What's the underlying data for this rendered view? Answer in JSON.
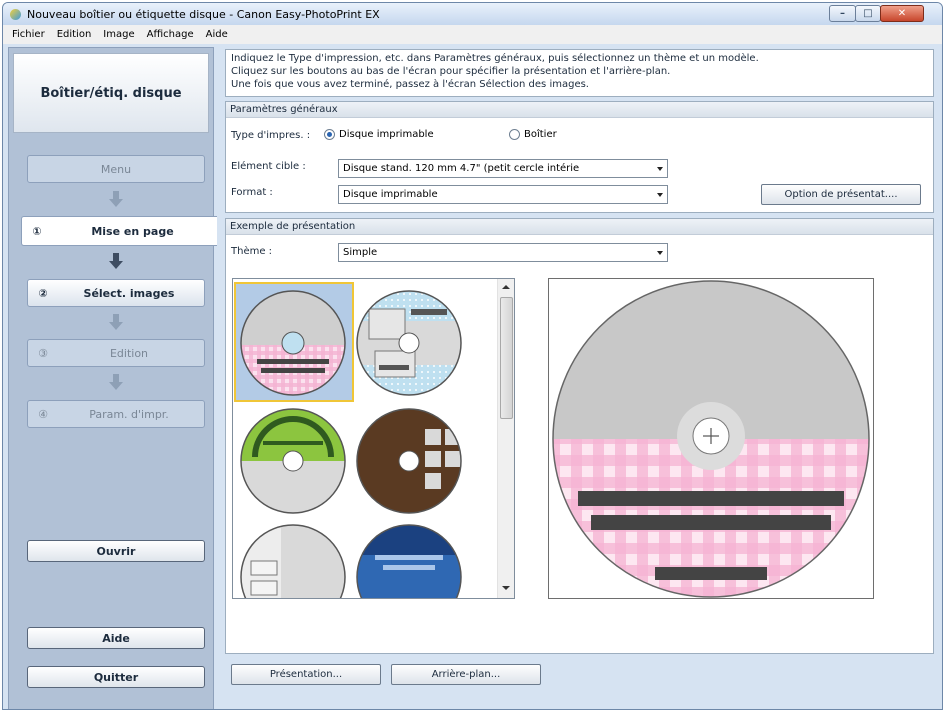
{
  "window": {
    "title": "Nouveau boîtier ou étiquette disque - Canon Easy-PhotoPrint EX"
  },
  "menubar": [
    "Fichier",
    "Edition",
    "Image",
    "Affichage",
    "Aide"
  ],
  "sidebar": {
    "title": "Boîtier/étiq. disque",
    "steps": [
      {
        "num": "",
        "label": "Menu"
      },
      {
        "num": "①",
        "label": "Mise en page"
      },
      {
        "num": "②",
        "label": "Sélect. images"
      },
      {
        "num": "③",
        "label": "Edition"
      },
      {
        "num": "④",
        "label": "Param. d'impr."
      }
    ],
    "open_label": "Ouvrir",
    "help_label": "Aide",
    "quit_label": "Quitter"
  },
  "instructions": [
    "Indiquez le Type d'impression, etc. dans Paramètres généraux, puis sélectionnez un thème et un modèle.",
    "Cliquez sur les boutons au bas de l'écran pour spécifier la présentation et l'arrière-plan.",
    "Une fois que vous avez terminé, passez à l'écran Sélection des images."
  ],
  "general": {
    "heading": "Paramètres généraux",
    "print_type_label": "Type d'impres. :",
    "option_disc": "Disque imprimable",
    "option_case": "Boîtier",
    "selected_print_type": "disc",
    "target_label": "Elément cible :",
    "target_value": "Disque stand. 120 mm 4.7\" (petit cercle intérie",
    "format_label": "Format :",
    "format_value": "Disque imprimable",
    "layout_options_label": "Option de présentat...."
  },
  "sample": {
    "heading": "Exemple de présentation",
    "theme_label": "Thème :",
    "theme_value": "Simple"
  },
  "bottom": {
    "layout_label": "Présentation...",
    "background_label": "Arrière-plan..."
  },
  "colors": {
    "accent": "#2a64b0",
    "selection": "#f0c637",
    "gingham": "#f2a9cc"
  }
}
